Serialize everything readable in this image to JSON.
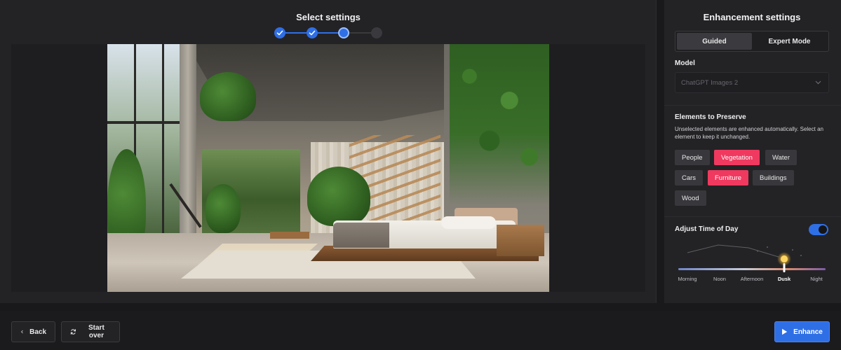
{
  "main": {
    "title": "Select settings",
    "steps": [
      {
        "state": "done"
      },
      {
        "state": "done"
      },
      {
        "state": "current"
      },
      {
        "state": "todo"
      }
    ]
  },
  "sidebar": {
    "title": "Enhancement settings",
    "modes": [
      "Guided",
      "Expert Mode"
    ],
    "active_mode": "Guided",
    "model": {
      "label": "Model",
      "value": "ChatGPT Images 2"
    },
    "preserve": {
      "label": "Elements to Preserve",
      "help": "Unselected elements are enhanced automatically. Select an element to keep it unchanged.",
      "elements": [
        {
          "label": "People",
          "selected": false
        },
        {
          "label": "Vegetation",
          "selected": true
        },
        {
          "label": "Water",
          "selected": false
        },
        {
          "label": "Cars",
          "selected": false
        },
        {
          "label": "Furniture",
          "selected": true
        },
        {
          "label": "Buildings",
          "selected": false
        },
        {
          "label": "Wood",
          "selected": false
        }
      ]
    },
    "time_of_day": {
      "label": "Adjust Time of Day",
      "enabled": true,
      "options": [
        "Morning",
        "Noon",
        "Afternoon",
        "Dusk",
        "Night"
      ],
      "selected": "Dusk"
    }
  },
  "footer": {
    "back_label": "Back",
    "start_over_label": "Start over",
    "enhance_label": "Enhance"
  },
  "colors": {
    "accent": "#2f6fe6",
    "chip_selected": "#f0395f",
    "background": "#19191b",
    "panel": "#232326"
  },
  "icons": {
    "back": "chevron-left-icon",
    "start_over": "refresh-icon",
    "enhance": "play-icon",
    "step_done": "check-icon",
    "select": "chevron-down-icon"
  }
}
